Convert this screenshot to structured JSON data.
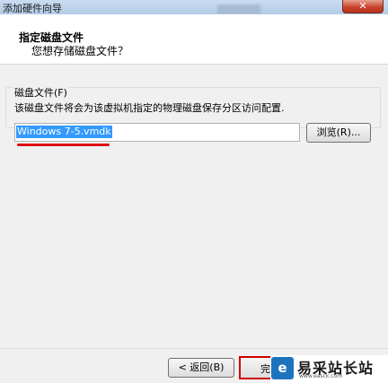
{
  "window": {
    "title": "添加硬件向导",
    "close_glyph": "✕"
  },
  "header": {
    "title": "指定磁盘文件",
    "subtitle": "您想存储磁盘文件？"
  },
  "disk_file": {
    "group_label": "磁盘文件(F)",
    "description": "该磁盘文件将会为该虚拟机指定的物理磁盘保存分区访问配置.",
    "value": "Windows 7-5.vmdk",
    "browse_label": "浏览(R)..."
  },
  "footer": {
    "back_label": "< 返回(B)",
    "next_label": "完"
  },
  "watermark": {
    "logo": "e",
    "name": "易采站长站",
    "url": "www.easck.com"
  },
  "colors": {
    "selection": "#3399ff",
    "highlight": "#d10000",
    "watermark_blue": "#1e73be"
  }
}
